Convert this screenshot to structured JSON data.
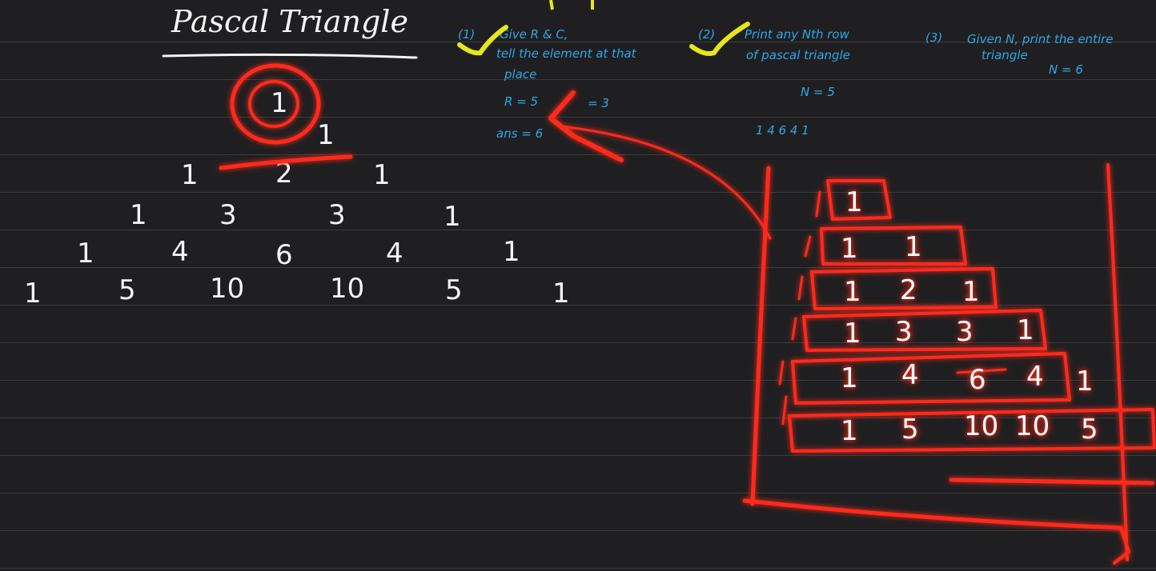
{
  "title": "Pascal Triangle",
  "triangle": {
    "row1": [
      "1"
    ],
    "row2": [
      "1"
    ],
    "row3": [
      "1",
      "2",
      "1"
    ],
    "row4": [
      "1",
      "3",
      "3",
      "1"
    ],
    "row5": [
      "1",
      "4",
      "6",
      "4",
      "1"
    ],
    "row6": [
      "1",
      "5",
      "10",
      "10",
      "5",
      "1"
    ]
  },
  "notes": {
    "q1_num": "(1)",
    "q1_line1": "Give R & C,",
    "q1_line2": "tell the element at that",
    "q1_line3": "place",
    "q1_r": "R = 5",
    "q1_c": "= 3",
    "q1_ans": "ans = 6",
    "q2_num": "(2)",
    "q2_line1": "Print any Nth row",
    "q2_line2": "of pascal triangle",
    "q2_n": "N = 5",
    "q2_row": "1   4   6   4   1",
    "q3_num": "(3)",
    "q3_line1": "Given N, print the entire",
    "q3_line2": "triangle",
    "q3_n": "N = 6"
  },
  "boxed": {
    "r1": [
      "1"
    ],
    "r2": [
      "1",
      "1"
    ],
    "r3": [
      "1",
      "2",
      "1"
    ],
    "r4": [
      "1",
      "3",
      "3",
      "1"
    ],
    "r5": [
      "1",
      "4",
      "6",
      "4",
      "1"
    ],
    "r6": [
      "1",
      "5",
      "10",
      "10",
      "5"
    ]
  },
  "colors": {
    "background": "#1f1f21",
    "chalk": "#f4f4f4",
    "highlight": "#ff2a1a",
    "notes": "#2ea6e8",
    "check": "#e6e61a"
  }
}
